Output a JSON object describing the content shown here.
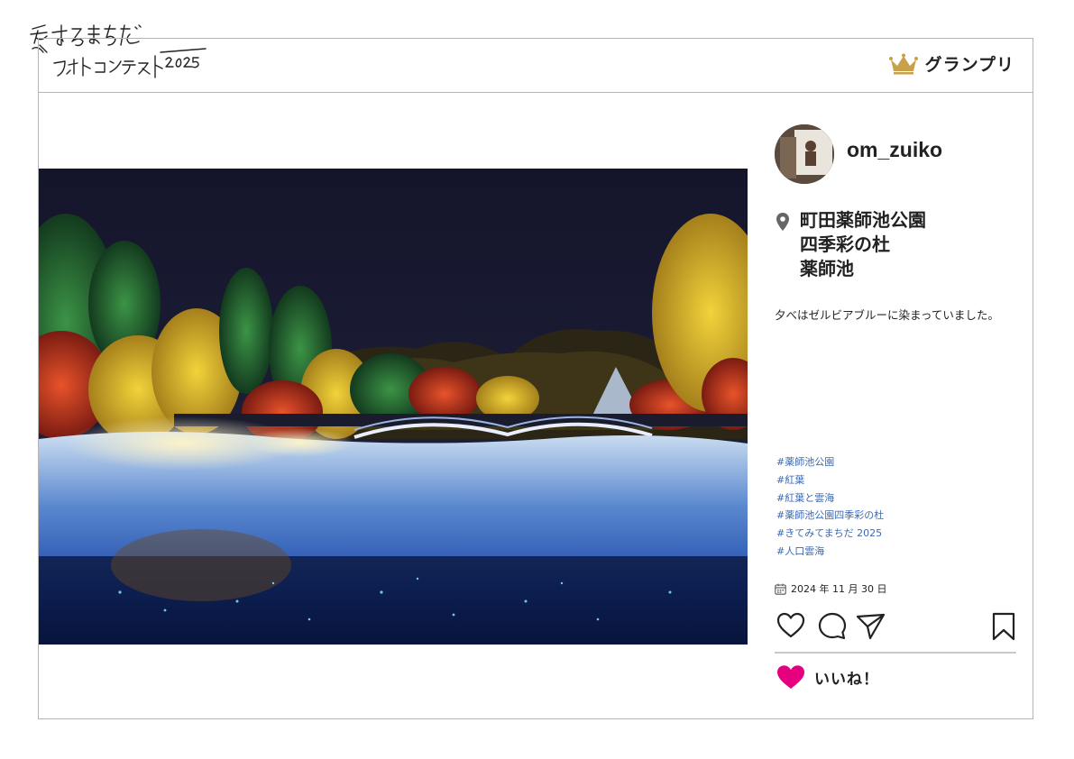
{
  "contest_logo": {
    "text": "愛するまちだフォトコンテスト2025"
  },
  "award": {
    "label": "グランプリ",
    "icon": "crown-icon",
    "color": "#c9a14a"
  },
  "post": {
    "username": "om_zuiko",
    "location_lines": [
      "町田薬師池公園",
      "四季彩の杜",
      "薬師池"
    ],
    "caption": "夕べはゼルビアブルーに染まっていました。",
    "hashtags": [
      "#薬師池公園",
      "#紅葉",
      "#紅葉と雲海",
      "#薬師池公園四季彩の杜",
      "#きてみてまちだ 2025",
      "#人口雲海"
    ],
    "date": "2024 年 11 月 30 日",
    "likes_label": "いいね！"
  },
  "colors": {
    "hashtag": "#3d6ab3",
    "like_heart": "#e5007f",
    "border": "#b5b5b5"
  }
}
